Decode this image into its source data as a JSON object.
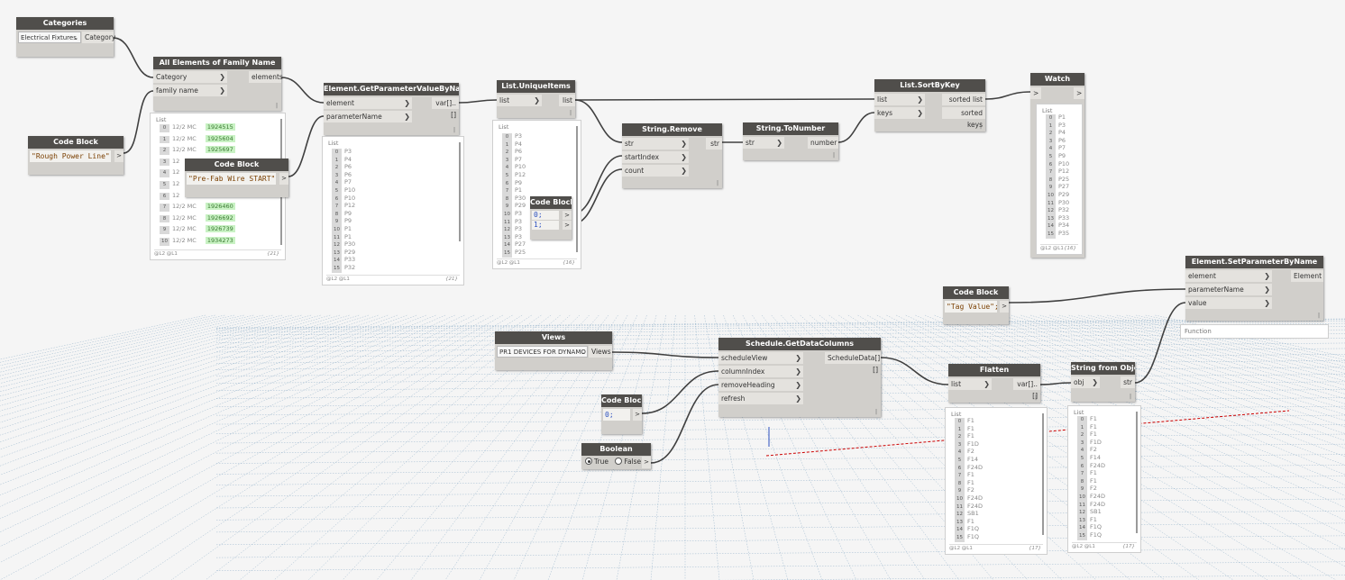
{
  "colors": {
    "node_header": "#504e4b",
    "node_body": "#d1cfcb",
    "wire": "#404040",
    "highlight_green": "#c9f2c4",
    "grid": "#5a8ab0",
    "axis_red": "#cc0000"
  },
  "nodes": {
    "categories": {
      "title": "Categories",
      "dropdown": "Electrical Fixtures",
      "output": "Category"
    },
    "all_elements": {
      "title": "All Elements of Family Name",
      "inputs": [
        "Category",
        "family name"
      ],
      "output": "elements"
    },
    "code_block_1": {
      "title": "Code Block",
      "code": "\"Rough Power Line\";",
      "out": ">"
    },
    "code_block_2": {
      "title": "Code Block",
      "code": "\"Pre-Fab Wire START\";",
      "out": ">"
    },
    "get_param": {
      "title": "Element.GetParameterValueByName",
      "inputs": [
        "element",
        "parameterName"
      ],
      "output": "var[]..[]"
    },
    "unique_items": {
      "title": "List.UniqueItems",
      "inputs": [
        "list"
      ],
      "output": "list"
    },
    "code_block_3": {
      "title": "Code Block",
      "lines": [
        "0;",
        "1;"
      ]
    },
    "string_remove": {
      "title": "String.Remove",
      "inputs": [
        "str",
        "startIndex",
        "count"
      ],
      "output": "str"
    },
    "to_number": {
      "title": "String.ToNumber",
      "inputs": [
        "str"
      ],
      "output": "number"
    },
    "sort_by_key": {
      "title": "List.SortByKey",
      "inputs": [
        "list",
        "keys"
      ],
      "outputs": [
        "sorted list",
        "sorted keys"
      ]
    },
    "watch": {
      "title": "Watch",
      "in": ">",
      "out": ">"
    },
    "set_param": {
      "title": "Element.SetParameterByName",
      "inputs": [
        "element",
        "parameterName",
        "value"
      ],
      "output": "Element",
      "function_label": "Function"
    },
    "code_block_tag": {
      "title": "Code Block",
      "code": "\"Tag Value\";",
      "out": ">"
    },
    "views": {
      "title": "Views",
      "dropdown": "PR1 DEVICES FOR DYNAMO",
      "output": "Views"
    },
    "schedule": {
      "title": "Schedule.GetDataColumns",
      "inputs": [
        "scheduleView",
        "columnIndex",
        "removeHeading",
        "refresh"
      ],
      "output": "ScheduleData[][]"
    },
    "code_block_0": {
      "title": "Code Block",
      "code": "0;",
      "out": ">"
    },
    "boolean": {
      "title": "Boolean",
      "true_label": "True",
      "false_label": "False",
      "out": ">"
    },
    "flatten": {
      "title": "Flatten",
      "inputs": [
        "list"
      ],
      "output": "var[]..[]"
    },
    "string_from_obj": {
      "title": "String from Object",
      "inputs": [
        "obj"
      ],
      "output": "str"
    }
  },
  "previews": {
    "all_elements": {
      "list_label": "List",
      "footer": "@L2 @L1",
      "count": "{21}",
      "rows": [
        {
          "i": "0",
          "t": "12/2 MC",
          "id": "1924515"
        },
        {
          "i": "1",
          "t": "12/2 MC",
          "id": "1925604"
        },
        {
          "i": "2",
          "t": "12/2 MC",
          "id": "1925697"
        },
        {
          "i": "3",
          "t": "12",
          "id": ""
        },
        {
          "i": "4",
          "t": "12",
          "id": ""
        },
        {
          "i": "5",
          "t": "12",
          "id": ""
        },
        {
          "i": "6",
          "t": "12",
          "id": ""
        },
        {
          "i": "7",
          "t": "12/2 MC",
          "id": "1926460"
        },
        {
          "i": "8",
          "t": "12/2 MC",
          "id": "1926692"
        },
        {
          "i": "9",
          "t": "12/2 MC",
          "id": "1926739"
        },
        {
          "i": "10",
          "t": "12/2 MC",
          "id": "1934273"
        }
      ]
    },
    "get_param": {
      "list_label": "List",
      "footer": "@L2 @L1",
      "count": "{21}",
      "rows": [
        [
          "0",
          "P3"
        ],
        [
          "1",
          "P4"
        ],
        [
          "2",
          "P6"
        ],
        [
          "3",
          "P6"
        ],
        [
          "4",
          "P7"
        ],
        [
          "5",
          "P10"
        ],
        [
          "6",
          "P10"
        ],
        [
          "7",
          "P12"
        ],
        [
          "8",
          "P9"
        ],
        [
          "9",
          "P9"
        ],
        [
          "10",
          "P1"
        ],
        [
          "11",
          "P1"
        ],
        [
          "12",
          "P30"
        ],
        [
          "13",
          "P29"
        ],
        [
          "14",
          "P33"
        ],
        [
          "15",
          "P32"
        ]
      ]
    },
    "unique_items": {
      "list_label": "List",
      "footer": "@L2 @L1",
      "count": "{16}",
      "rows": [
        [
          "0",
          "P3"
        ],
        [
          "1",
          "P4"
        ],
        [
          "2",
          "P6"
        ],
        [
          "3",
          "P7"
        ],
        [
          "4",
          "P10"
        ],
        [
          "5",
          "P12"
        ],
        [
          "6",
          "P9"
        ],
        [
          "7",
          "P1"
        ],
        [
          "8",
          "P30"
        ],
        [
          "9",
          "P29"
        ],
        [
          "10",
          "P3"
        ],
        [
          "11",
          "P3"
        ],
        [
          "12",
          "P3"
        ],
        [
          "13",
          "P3"
        ],
        [
          "14",
          "P27"
        ],
        [
          "15",
          "P25"
        ]
      ]
    },
    "watch": {
      "list_label": "List",
      "footer": "@L2 @L1",
      "count": "{16}",
      "rows": [
        [
          "0",
          "P1"
        ],
        [
          "1",
          "P3"
        ],
        [
          "2",
          "P4"
        ],
        [
          "3",
          "P6"
        ],
        [
          "4",
          "P7"
        ],
        [
          "5",
          "P9"
        ],
        [
          "6",
          "P10"
        ],
        [
          "7",
          "P12"
        ],
        [
          "8",
          "P25"
        ],
        [
          "9",
          "P27"
        ],
        [
          "10",
          "P29"
        ],
        [
          "11",
          "P30"
        ],
        [
          "12",
          "P32"
        ],
        [
          "13",
          "P33"
        ],
        [
          "14",
          "P34"
        ],
        [
          "15",
          "P35"
        ]
      ]
    },
    "flatten": {
      "list_label": "List",
      "footer": "@L2 @L1",
      "count": "{17}",
      "rows": [
        [
          "0",
          "F1"
        ],
        [
          "1",
          "F1"
        ],
        [
          "2",
          "F1"
        ],
        [
          "3",
          "F1D"
        ],
        [
          "4",
          "F2"
        ],
        [
          "5",
          "F14"
        ],
        [
          "6",
          "F24D"
        ],
        [
          "7",
          "F1"
        ],
        [
          "8",
          "F1"
        ],
        [
          "9",
          "F2"
        ],
        [
          "10",
          "F24D"
        ],
        [
          "11",
          "F24D"
        ],
        [
          "12",
          "SB1"
        ],
        [
          "13",
          "F1"
        ],
        [
          "14",
          "F1Q"
        ],
        [
          "15",
          "F1Q"
        ]
      ]
    },
    "string_from_obj": {
      "list_label": "List",
      "footer": "@L2 @L1",
      "count": "{17}",
      "rows": [
        [
          "0",
          "F1"
        ],
        [
          "1",
          "F1"
        ],
        [
          "2",
          "F1"
        ],
        [
          "3",
          "F1D"
        ],
        [
          "4",
          "F2"
        ],
        [
          "5",
          "F14"
        ],
        [
          "6",
          "F24D"
        ],
        [
          "7",
          "F1"
        ],
        [
          "8",
          "F1"
        ],
        [
          "9",
          "F2"
        ],
        [
          "10",
          "F24D"
        ],
        [
          "11",
          "F24D"
        ],
        [
          "12",
          "SB1"
        ],
        [
          "13",
          "F1"
        ],
        [
          "14",
          "F1Q"
        ],
        [
          "15",
          "F1Q"
        ]
      ]
    }
  }
}
